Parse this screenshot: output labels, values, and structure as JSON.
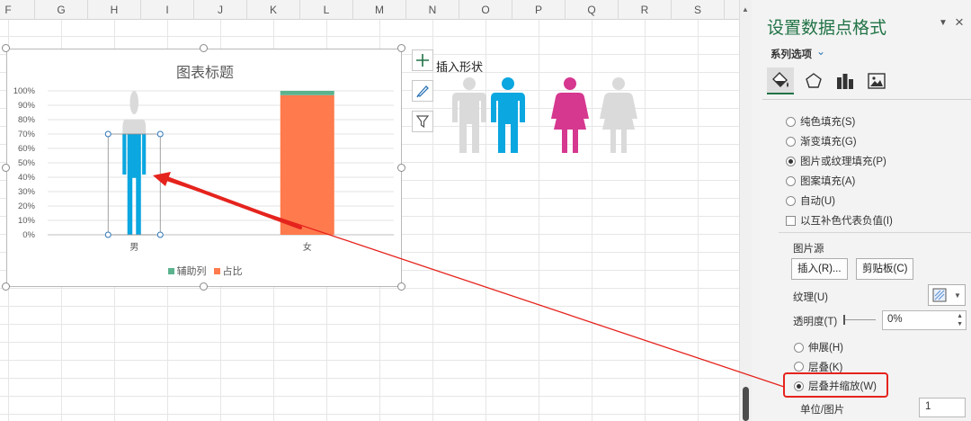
{
  "sheet": {
    "columns": [
      "F",
      "G",
      "H",
      "I",
      "J",
      "K",
      "L",
      "M",
      "N",
      "O",
      "P",
      "Q",
      "R",
      "S"
    ]
  },
  "chart_data": {
    "type": "bar",
    "stacked": true,
    "title": "图表标题",
    "categories": [
      "男",
      "女"
    ],
    "series": [
      {
        "name": "辅助列",
        "color": "#5bb38e",
        "values": [
          0.3,
          0.03
        ]
      },
      {
        "name": "占比",
        "color": "#ff7a4d",
        "values": [
          0.7,
          0.97
        ]
      }
    ],
    "ylim": [
      0,
      1
    ],
    "yticks": [
      "0%",
      "10%",
      "20%",
      "30%",
      "40%",
      "50%",
      "60%",
      "70%",
      "80%",
      "90%",
      "100%"
    ],
    "grid": true,
    "legend": "bottom"
  },
  "chart_tools": {
    "insert_shape_label": "插入形状"
  },
  "colors": {
    "male_blue": "#0aa7e0",
    "female_pink": "#d6378f",
    "placeholder_gray": "#dadada",
    "accent_green": "#217346",
    "arrow_red": "#e5231d"
  },
  "pane": {
    "title": "设置数据点格式",
    "series_options": "系列选项",
    "fill_options": [
      {
        "label": "纯色填充(S)",
        "selected": false
      },
      {
        "label": "渐变填充(G)",
        "selected": false
      },
      {
        "label": "图片或纹理填充(P)",
        "selected": true
      },
      {
        "label": "图案填充(A)",
        "selected": false
      },
      {
        "label": "自动(U)",
        "selected": false
      }
    ],
    "invert_negative": "以互补色代表负值(I)",
    "picture_source": "图片源",
    "insert_button": "插入(R)...",
    "clipboard_button": "剪贴板(C)",
    "texture_label": "纹理(U)",
    "transparency_label": "透明度(T)",
    "transparency_value": "0%",
    "stretch_options": [
      {
        "label": "伸展(H)",
        "selected": false
      },
      {
        "label": "层叠(K)",
        "selected": false
      },
      {
        "label": "层叠并缩放(W)",
        "selected": true
      }
    ],
    "unit_label": "单位/图片",
    "unit_value": "1"
  }
}
